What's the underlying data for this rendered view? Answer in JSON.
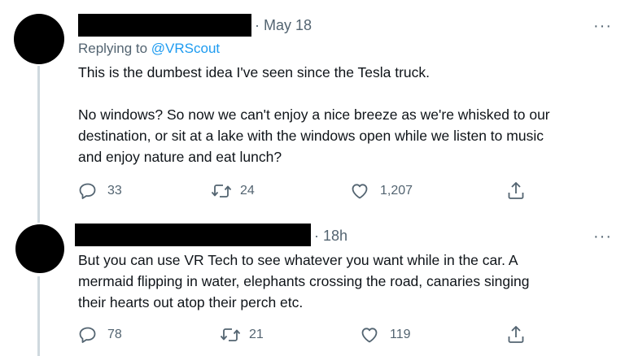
{
  "tweets": [
    {
      "timestamp": "May 18",
      "reply_prefix": "Replying to ",
      "reply_handle": "@VRScout",
      "text": "This is the dumbest idea I've seen since the Tesla truck.\n\nNo windows? So now we can't enjoy a nice breeze as we're whisked to our\ndestination, or sit at a lake with the windows open while we listen to music\nand enjoy nature and eat lunch?",
      "replies": "33",
      "retweets": "24",
      "likes": "1,207",
      "more": "···"
    },
    {
      "timestamp": "18h",
      "text": "But you can use VR Tech to see whatever you want while in the car. A\nmermaid flipping in water, elephants crossing the road, canaries singing\ntheir hearts out atop their perch etc.",
      "replies": "78",
      "retweets": "21",
      "likes": "119",
      "more": "···"
    }
  ],
  "icons": {
    "reply": "reply-icon",
    "retweet": "retweet-icon",
    "like": "heart-icon",
    "share": "share-icon",
    "more": "more-icon"
  },
  "colors": {
    "link": "#1d9bf0",
    "secondary": "#536471",
    "text": "#0f1419",
    "thread_line": "#cfd9de"
  }
}
